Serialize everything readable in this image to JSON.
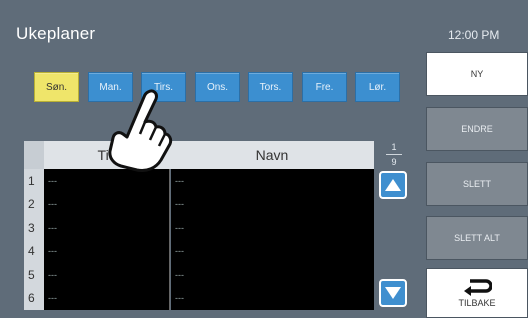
{
  "header": {
    "title": "Ukeplaner",
    "clock": "12:00 PM"
  },
  "days": [
    {
      "label": "Søn.",
      "active": true
    },
    {
      "label": "Man.",
      "active": false
    },
    {
      "label": "Tirs.",
      "active": false
    },
    {
      "label": "Ons.",
      "active": false
    },
    {
      "label": "Tors.",
      "active": false
    },
    {
      "label": "Fre.",
      "active": false
    },
    {
      "label": "Lør.",
      "active": false
    }
  ],
  "table": {
    "col_tid": "Tid",
    "col_navn": "Navn",
    "rows": [
      {
        "num": "1",
        "tid": "---",
        "navn": "---"
      },
      {
        "num": "2",
        "tid": "---",
        "navn": "---"
      },
      {
        "num": "3",
        "tid": "---",
        "navn": "---"
      },
      {
        "num": "4",
        "tid": "---",
        "navn": "---"
      },
      {
        "num": "5",
        "tid": "---",
        "navn": "---"
      },
      {
        "num": "6",
        "tid": "---",
        "navn": "---"
      }
    ]
  },
  "pager": {
    "current": "1",
    "total": "9"
  },
  "sidebar": {
    "ny": "NY",
    "endre": "ENDRE",
    "slett": "SLETT",
    "slett_alt": "SLETT ALT",
    "tilbake": "TILBAKE"
  },
  "colors": {
    "background": "#5f6c79",
    "day_button": "#3c8fd0",
    "day_active": "#efe56a",
    "button_enabled": "#ffffff",
    "button_disabled": "#7f8891"
  },
  "icons": [
    "up-arrow-icon",
    "down-arrow-icon",
    "back-arrow-icon",
    "tap-hand-icon"
  ]
}
